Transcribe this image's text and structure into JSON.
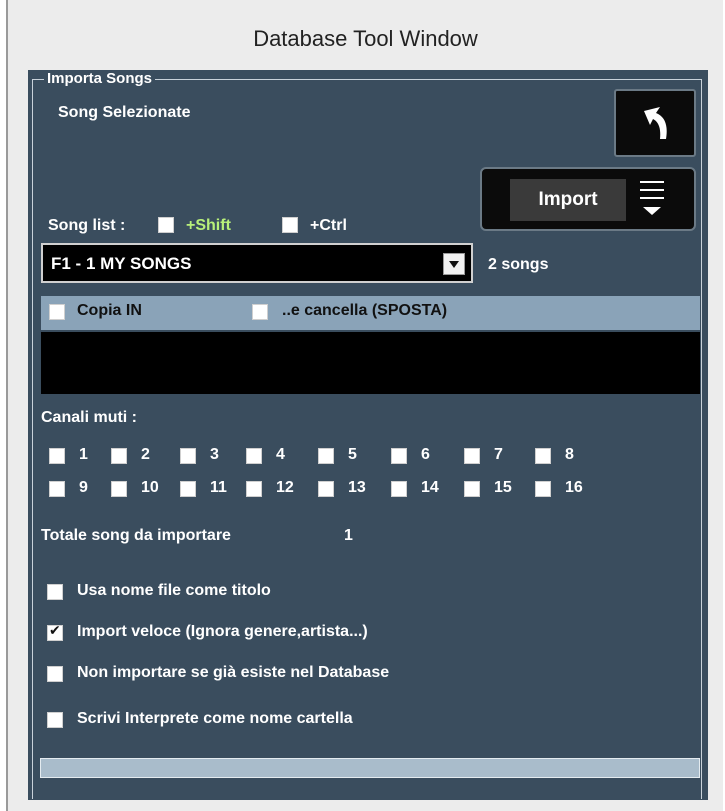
{
  "window": {
    "title": "Database Tool Window"
  },
  "group": {
    "legend": "Importa Songs"
  },
  "selected_label": "Song Selezionate",
  "import": {
    "label": "Import"
  },
  "song_list": {
    "label": "Song list :",
    "shift_label": "+Shift",
    "ctrl_label": "+Ctrl",
    "selected_value": "F1 - 1 MY SONGS",
    "count_text": "2 songs"
  },
  "copy": {
    "copia_label": "Copia IN",
    "sposta_label": "..e cancella (SPOSTA)"
  },
  "channels": {
    "label": "Canali muti :",
    "row1": [
      "1",
      "2",
      "3",
      "4",
      "5",
      "6",
      "7",
      "8"
    ],
    "row2": [
      "9",
      "10",
      "11",
      "12",
      "13",
      "14",
      "15",
      "16"
    ]
  },
  "totale": {
    "label": "Totale song da importare",
    "value": "1"
  },
  "options": [
    {
      "label": "Usa nome file come titolo",
      "checked": false
    },
    {
      "label": "Import veloce (Ignora genere,artista...)",
      "checked": true
    },
    {
      "label": "Non importare se già esiste nel Database",
      "checked": false
    },
    {
      "label": "Scrivi Interprete come nome cartella",
      "checked": false
    }
  ],
  "icons": {
    "back": "back-arrow-icon",
    "menu": "menu-dropdown-icon",
    "dropdown": "chevron-down-icon"
  },
  "colors": {
    "panel": "#3a4d5e",
    "accent_green": "#b8f07a",
    "bar": "#8aa3b8"
  }
}
